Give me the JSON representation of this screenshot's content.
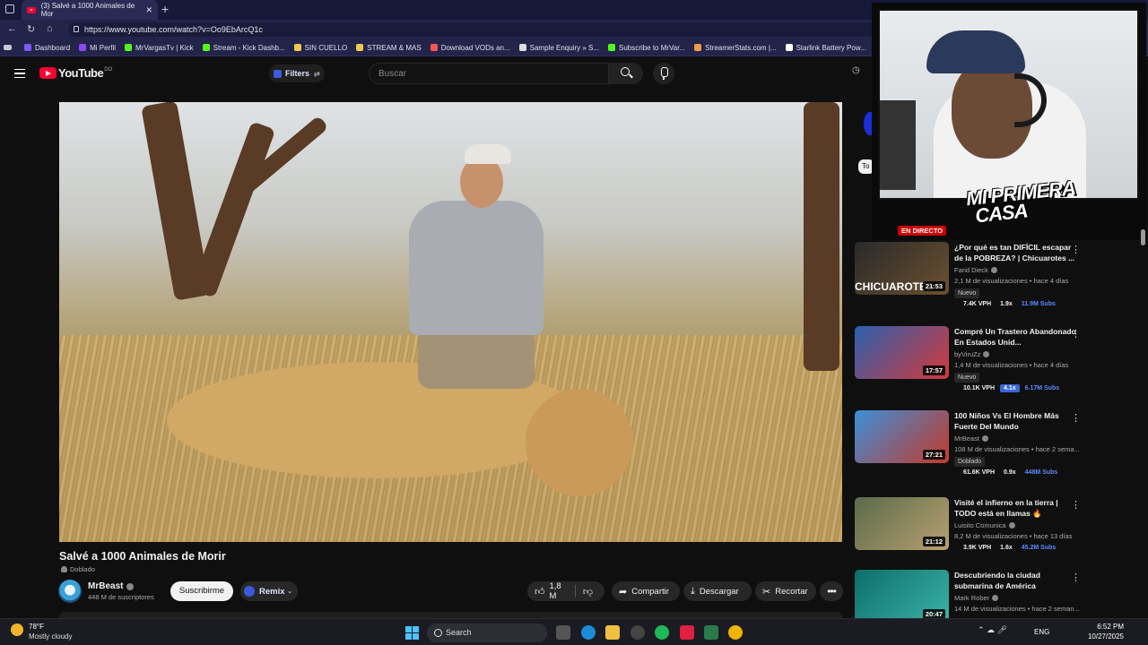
{
  "browser": {
    "tab_title": "(3) Salvé a 1000 Animales de Mor",
    "url": "https://www.youtube.com/watch?v=Oo9EbArcQ1c",
    "bookmarks": [
      {
        "label": "Dashboard",
        "color": "#7b5cff"
      },
      {
        "label": "Mi Perfil",
        "color": "#9146ff"
      },
      {
        "label": "MrVargasTv | Kick",
        "color": "#53fc18"
      },
      {
        "label": "Stream - Kick Dashb...",
        "color": "#53fc18"
      },
      {
        "label": "SIN CUELLO",
        "color": "#f2c94c"
      },
      {
        "label": "STREAM & MAS",
        "color": "#f2c94c"
      },
      {
        "label": "Download VODs an...",
        "color": "#ff5555"
      },
      {
        "label": "Sample Enquiry » S...",
        "color": "#dddddd"
      },
      {
        "label": "Subscribe to MrVar...",
        "color": "#53fc18"
      },
      {
        "label": "StreamerStats.com |...",
        "color": "#f2994a"
      },
      {
        "label": "Starlink Battery Pow...",
        "color": "#ffffff"
      }
    ]
  },
  "youtube": {
    "logo_text": "YouTube",
    "logo_country": "DO",
    "filters_label": "Filters",
    "search_placeholder": "Buscar"
  },
  "video": {
    "title": "Salvé a 1000 Animales de Morir",
    "dubbed_label": "Doblado",
    "channel_name": "MrBeast",
    "subscribers": "448 M de suscriptores",
    "subscribe_label": "Suscribirme",
    "remix_label": "Remix",
    "likes": "1,8 M",
    "share_label": "Compartir",
    "download_label": "Descargar",
    "clip_label": "Recortar"
  },
  "sidebar": {
    "chip_label": "To",
    "live_badge": "EN DIRECTO",
    "overlay_title_line1": "MI PRIMERA",
    "overlay_title_line2": "CASA",
    "recommendations": [
      {
        "title": "¿Por qué es tan DIFÍCIL escapar de la POBREZA? | Chicuarotes ...",
        "channel": "Farid Dieck",
        "meta": "2,1 M de visualizaciones • hace 4 días",
        "badge": "Nuevo",
        "duration": "21:53",
        "thumb_text": "CHICUAROTES",
        "stat_vph": "7.4K VPH",
        "stat_mult": "1.9x",
        "stat_subs": "11.9M Subs",
        "thumb_colors": [
          "#2a2a2a",
          "#6b5030"
        ]
      },
      {
        "title": "Compré Un Trastero Abandonado En Estados Unid...",
        "channel": "byViruZz",
        "meta": "1,4 M de visualizaciones • hace 4 días",
        "badge": "Nuevo",
        "duration": "17:57",
        "thumb_text": "",
        "stat_vph": "10.1K VPH",
        "stat_mult": "4.1x",
        "stat_subs": "6.17M Subs",
        "thumb_colors": [
          "#2c5fb0",
          "#d23a3a"
        ]
      },
      {
        "title": "100 Niños Vs El Hombre Más Fuerte Del Mundo",
        "channel": "MrBeast",
        "meta": "108 M de visualizaciones • hace 2 sema...",
        "badge": "Doblado",
        "duration": "27:21",
        "thumb_text": "",
        "stat_vph": "61.6K VPH",
        "stat_mult": "0.9x",
        "stat_subs": "448M Subs",
        "thumb_colors": [
          "#3a8fd8",
          "#c43a2a"
        ]
      },
      {
        "title": "Visité el infierno en la tierra | TODO está en llamas 🔥",
        "channel": "Luisito Comunica",
        "meta": "8,2 M de visualizaciones • hace 13 días",
        "badge": "",
        "duration": "21:12",
        "thumb_text": "",
        "stat_vph": "3.9K VPH",
        "stat_mult": "1.6x",
        "stat_subs": "45.2M Subs",
        "thumb_colors": [
          "#5a6b4a",
          "#b8a070"
        ]
      },
      {
        "title": "Descubriendo la ciudad submarina de América",
        "channel": "Mark Rober",
        "meta": "14 M de visualizaciones • hace 2 seman...",
        "badge": "",
        "duration": "20:47",
        "thumb_text": "",
        "stat_vph": "",
        "stat_mult": "",
        "stat_subs": "",
        "thumb_colors": [
          "#0d6e6a",
          "#3bb3a6"
        ]
      }
    ]
  },
  "taskbar": {
    "temperature": "78°F",
    "weather": "Mostly cloudy",
    "search_label": "Search",
    "language": "ENG",
    "time": "6:52 PM",
    "date": "10/27/2025"
  }
}
